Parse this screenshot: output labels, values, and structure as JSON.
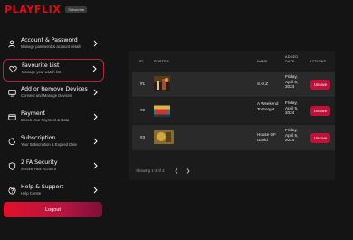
{
  "app": {
    "logo": "PLAYFLIX",
    "badge": "Subscribe"
  },
  "sidebar": {
    "items": [
      {
        "title": "Account & Password",
        "subtitle": "Manage password & account details",
        "icon": "user-settings-icon"
      },
      {
        "title": "Favourite List",
        "subtitle": "Manage your watch list",
        "icon": "heart-icon",
        "active": true
      },
      {
        "title": "Add or Remove Devices",
        "subtitle": "Connect and Manage Devices",
        "icon": "devices-icon"
      },
      {
        "title": "Payment",
        "subtitle": "Check Your Payment & Data",
        "icon": "credit-card-icon"
      },
      {
        "title": "Subscription",
        "subtitle": "Your Subscription & Expired Date",
        "icon": "subscription-icon"
      },
      {
        "title": "2 FA Security",
        "subtitle": "Secure Your Account",
        "icon": "shield-icon"
      },
      {
        "title": "Help & Support",
        "subtitle": "Help Centre",
        "icon": "help-icon"
      }
    ],
    "logout_label": "Logout"
  },
  "table": {
    "headers": {
      "id": "ID",
      "poster": "POSTER",
      "name": "NAME",
      "added": "ADDED DATE",
      "actions": "ACTIONS"
    },
    "rows": [
      {
        "id": "#1",
        "name": "S.O.Z",
        "date": "Friday, April 5, 2024",
        "action": "Unsave"
      },
      {
        "id": "#2",
        "name": "A Weekend To Forget",
        "date": "Friday, April 5, 2024",
        "action": "Unsave"
      },
      {
        "id": "#3",
        "name": "House OF David",
        "date": "Friday, April 5, 2024",
        "action": "Unsave"
      }
    ],
    "pagination": "Showing 1-3 of 3"
  },
  "colors": {
    "brand": "#e50914",
    "accent": "#c0113a",
    "background": "#141414"
  }
}
